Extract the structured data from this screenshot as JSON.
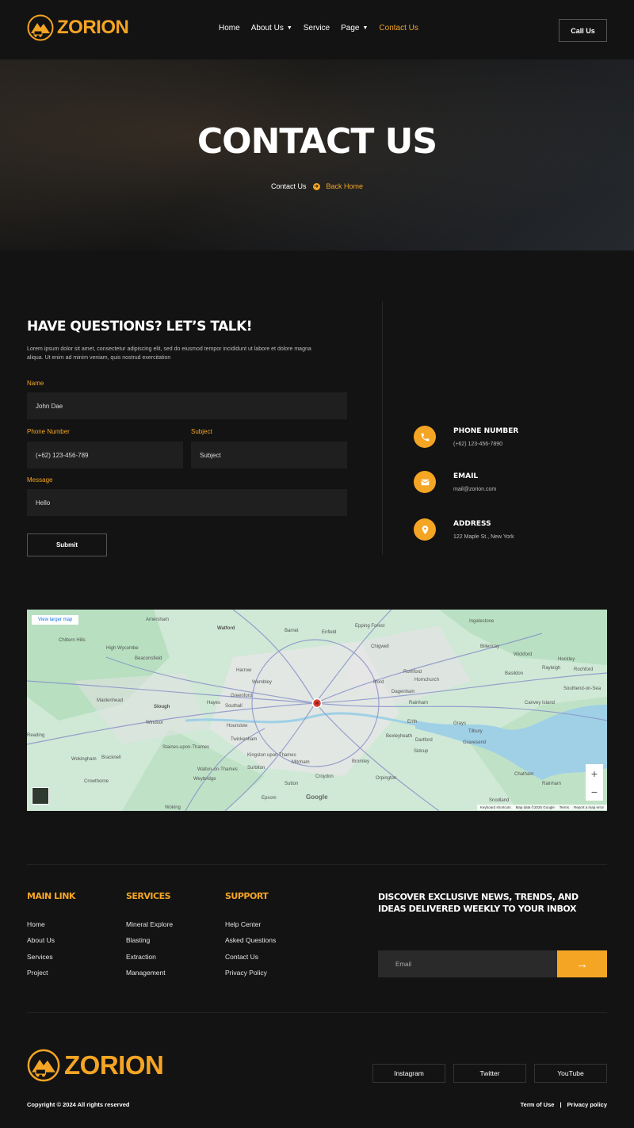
{
  "brand": {
    "name": "ZORION",
    "accent": "#f5a524"
  },
  "nav": {
    "items": [
      {
        "label": "Home",
        "dropdown": false
      },
      {
        "label": "About Us",
        "dropdown": true
      },
      {
        "label": "Service",
        "dropdown": false
      },
      {
        "label": "Page",
        "dropdown": true
      },
      {
        "label": "Contact Us",
        "dropdown": false,
        "active": true
      }
    ],
    "call_label": "Call Us"
  },
  "hero": {
    "title": "CONTACT US",
    "crumb_current": "Contact Us",
    "crumb_link": "Back Home"
  },
  "contact": {
    "title": "HAVE QUESTIONS? LET’S TALK!",
    "desc": "Lorem ipsum dolor sit amet, consectetur adipiscing elit, sed do eiusmod tempor incididunt ut labore et dolore magna aliqua. Ut enim ad minim veniam, quis nostrud exercitation",
    "name_label": "Name",
    "name_value": "John Dae",
    "phone_label": "Phone Number",
    "phone_value": "(+62) 123-456-789",
    "subject_label": "Subject",
    "subject_placeholder": "Subject",
    "message_label": "Message",
    "message_value": "Hello",
    "submit_label": "Submit"
  },
  "info": [
    {
      "icon": "phone-icon",
      "title": "PHONE NUMBER",
      "value": "(+62) 123-456-7890"
    },
    {
      "icon": "email-icon",
      "title": "EMAIL",
      "value": "mail@zorion.com"
    },
    {
      "icon": "location-pin-icon",
      "title": "ADDRESS",
      "value": "122 Maple St., New York"
    }
  ],
  "map": {
    "view_larger": "View larger map",
    "places": [
      "Watford",
      "Barnet",
      "Enfield",
      "Epping Forest",
      "Ingatestone",
      "Amersham",
      "High Wycombe",
      "Beaconsfield",
      "Harrow",
      "Wembley",
      "Romford",
      "Hornchurch",
      "Basildon",
      "Slough",
      "Hayes",
      "Southall",
      "Ilford",
      "Dagenham",
      "Rainham",
      "Canvey Island",
      "Southend-on-Sea",
      "Maidenhead",
      "Windsor",
      "Hounslow",
      "Erith",
      "Grays",
      "Tilbury",
      "Reading",
      "Twickenham",
      "Kingston upon Thames",
      "Bexleyheath",
      "Dartford",
      "Gravesend",
      "Staines-upon-Thames",
      "Mitcham",
      "Bromley",
      "Bracknell",
      "Wokingham",
      "Walton-on-Thames",
      "Croydon",
      "Orpington",
      "Chatham",
      "Crowthorne",
      "Weybridge",
      "Sutton",
      "Epsom",
      "Woking",
      "Sevenoaks",
      "Chiltern Hills",
      "Wickford",
      "Rayleigh",
      "Billericay",
      "Chigwell",
      "Greenford",
      "Surbiton",
      "Sidcup",
      "Hockley",
      "Rochford",
      "Rainham",
      "Snodland"
    ],
    "footer": [
      "Keyboard shortcuts",
      "Map data ©2025 Google",
      "Terms",
      "Report a map error"
    ],
    "google": "Google"
  },
  "footer": {
    "col1_title": "MAIN LINK",
    "col1": [
      "Home",
      "About Us",
      "Services",
      "Project"
    ],
    "col2_title": "SERVICES",
    "col2": [
      "Mineral Explore",
      "Blasting",
      "Extraction",
      "Management"
    ],
    "col3_title": "SUPPORT",
    "col3": [
      "Help Center",
      "Asked Questions",
      "Contact Us",
      "Privacy Policy"
    ],
    "newsletter_title": "DISCOVER EXCLUSIVE NEWS, TRENDS, AND IDEAS DELIVERED WEEKLY TO YOUR INBOX",
    "email_placeholder": "Email",
    "social": [
      "Instagram",
      "Twitter",
      "YouTube"
    ],
    "copyright": "Copyright © 2024 All rights reserved",
    "terms": "Term of Use",
    "sep": "|",
    "privacy": "Privacy policy"
  }
}
